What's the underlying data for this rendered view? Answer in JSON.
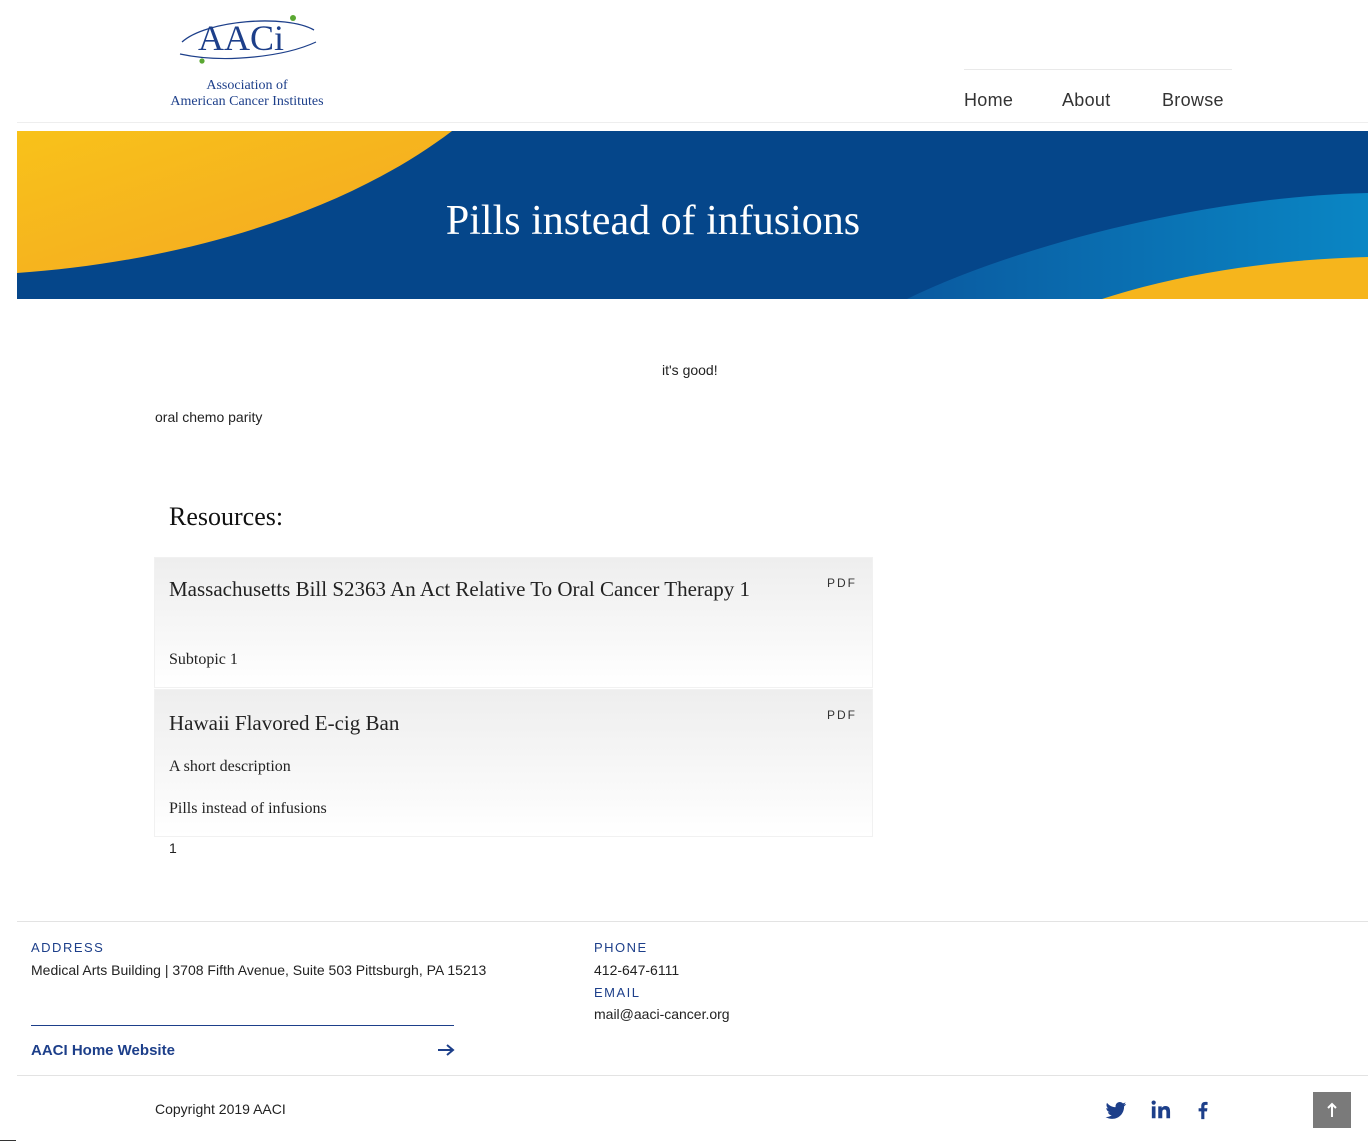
{
  "header": {
    "logo": {
      "wordmark": "AACi",
      "subtitle_line1": "Association of",
      "subtitle_line2": "American Cancer Institutes",
      "colors": {
        "navy": "#1d3f8a",
        "green": "#5aa832"
      }
    },
    "nav": [
      {
        "label": "Home"
      },
      {
        "label": "About"
      },
      {
        "label": "Browse"
      }
    ]
  },
  "banner": {
    "title": "Pills instead of infusions",
    "colors": {
      "navy": "#05468a",
      "yellow": "#f7b51d",
      "blue": "#0a7fc1"
    }
  },
  "content": {
    "status_text": "it's good!",
    "description": "oral chemo parity",
    "resources_heading": "Resources:",
    "resources": [
      {
        "title": "Massachusetts Bill S2363 An Act Relative To Oral Cancer Therapy 1",
        "tag": "PDF",
        "lines": [
          "Subtopic 1"
        ]
      },
      {
        "title": "Hawaii Flavored E-cig Ban",
        "tag": "PDF",
        "lines": [
          "A short description",
          "Pills instead of infusions"
        ]
      }
    ],
    "pagination": "1"
  },
  "footer": {
    "address_label": "ADDRESS",
    "address": "Medical Arts Building | 3708 Fifth Avenue, Suite 503 Pittsburgh, PA 15213",
    "phone_label": "PHONE",
    "phone": "412-647-6111",
    "email_label": "EMAIL",
    "email": "mail@aaci-cancer.org",
    "home_link": "AACI Home Website",
    "copyright": "Copyright 2019 AACI",
    "social_icons": [
      "twitter-icon",
      "linkedin-icon",
      "facebook-icon"
    ],
    "back_to_top_icon": "arrow-up-icon",
    "accent_color": "#1d3f8a"
  }
}
